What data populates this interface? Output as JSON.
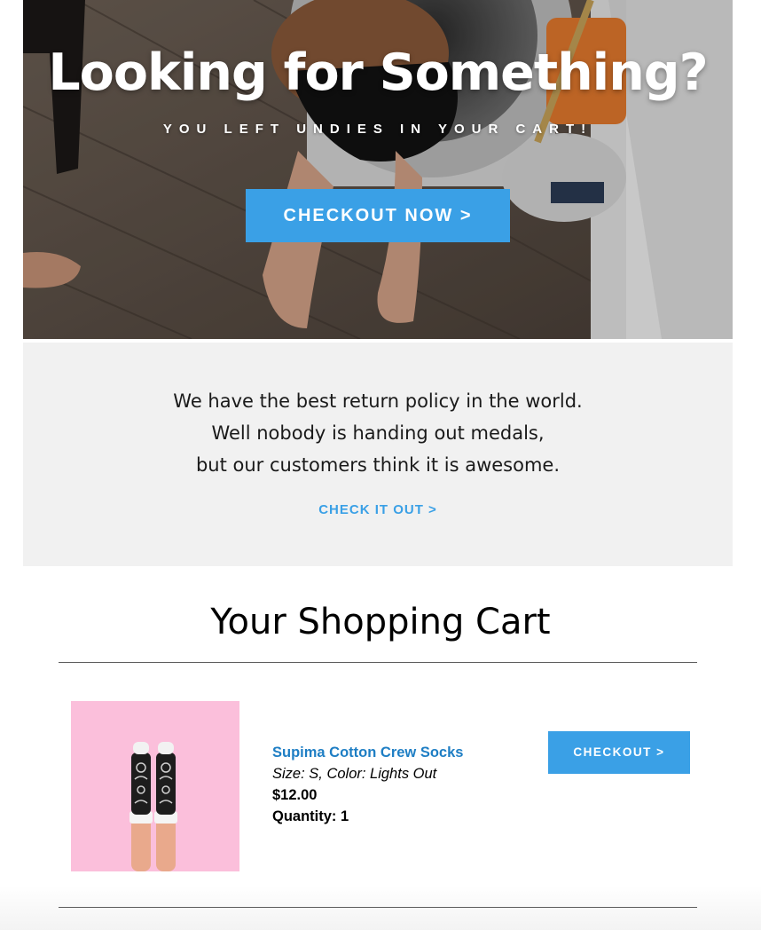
{
  "hero": {
    "title": "Looking for Something?",
    "subtitle": "YOU LEFT UNDIES IN YOUR CART!",
    "cta_label": "CHECKOUT NOW >"
  },
  "policy": {
    "lines": [
      "We have the best return policy in the world.",
      "Well nobody is handing out medals,",
      "but our customers think it is awesome."
    ],
    "link_label": "CHECK IT OUT >"
  },
  "cart": {
    "title": "Your Shopping Cart",
    "items": [
      {
        "name": "Supima Cotton Crew Socks",
        "variant": "Size: S, Color: Lights Out",
        "price": "$12.00",
        "quantity_label": "Quantity:",
        "quantity": "1",
        "checkout_label": "CHECKOUT >"
      }
    ]
  },
  "colors": {
    "accent": "#3aa0e6",
    "link": "#1e7ec4",
    "policy_bg": "#f1f1f1",
    "product_bg": "#fbbfdb"
  }
}
